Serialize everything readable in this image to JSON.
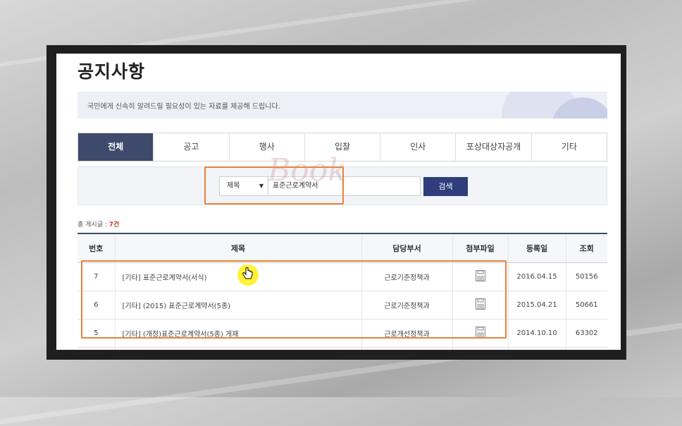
{
  "page": {
    "title": "공지사항",
    "description": "국민에게 신속히 알려드릴 필요성이 있는 자료를 제공해 드립니다."
  },
  "tabs": [
    {
      "label": "전체",
      "active": true
    },
    {
      "label": "공고",
      "active": false
    },
    {
      "label": "행사",
      "active": false
    },
    {
      "label": "입찰",
      "active": false
    },
    {
      "label": "인사",
      "active": false
    },
    {
      "label": "포상대상자공개",
      "active": false
    },
    {
      "label": "기타",
      "active": false
    }
  ],
  "search": {
    "select_value": "제목",
    "input_value": "표준근로계약서",
    "button_label": "검색"
  },
  "count": {
    "label": "총 게시글 : ",
    "value": "7건"
  },
  "table": {
    "headers": [
      "번호",
      "제목",
      "담당부서",
      "첨부파일",
      "등록일",
      "조회"
    ],
    "rows": [
      {
        "no": "7",
        "title": "[기타] 표준근로계약서(서식)",
        "dept": "근로기준정책과",
        "date": "2016.04.15",
        "views": "50156"
      },
      {
        "no": "6",
        "title": "[기타] (2015) 표준근로계약서(5종)",
        "dept": "근로기준정책과",
        "date": "2015.04.21",
        "views": "50661"
      },
      {
        "no": "5",
        "title": "[기타] (개정)표준근로계약서(5종) 게재",
        "dept": "근로개선정책과",
        "date": "2014.10.10",
        "views": "63302"
      }
    ]
  },
  "watermark": "Book",
  "colors": {
    "active_tab": "#3d4a6b",
    "search_button": "#2f3d7d",
    "highlight": "#e8823a",
    "count_number": "#c0392b"
  },
  "icons": {
    "attachment": "floppy-disk-icon",
    "cursor": "hand-pointer-icon"
  }
}
